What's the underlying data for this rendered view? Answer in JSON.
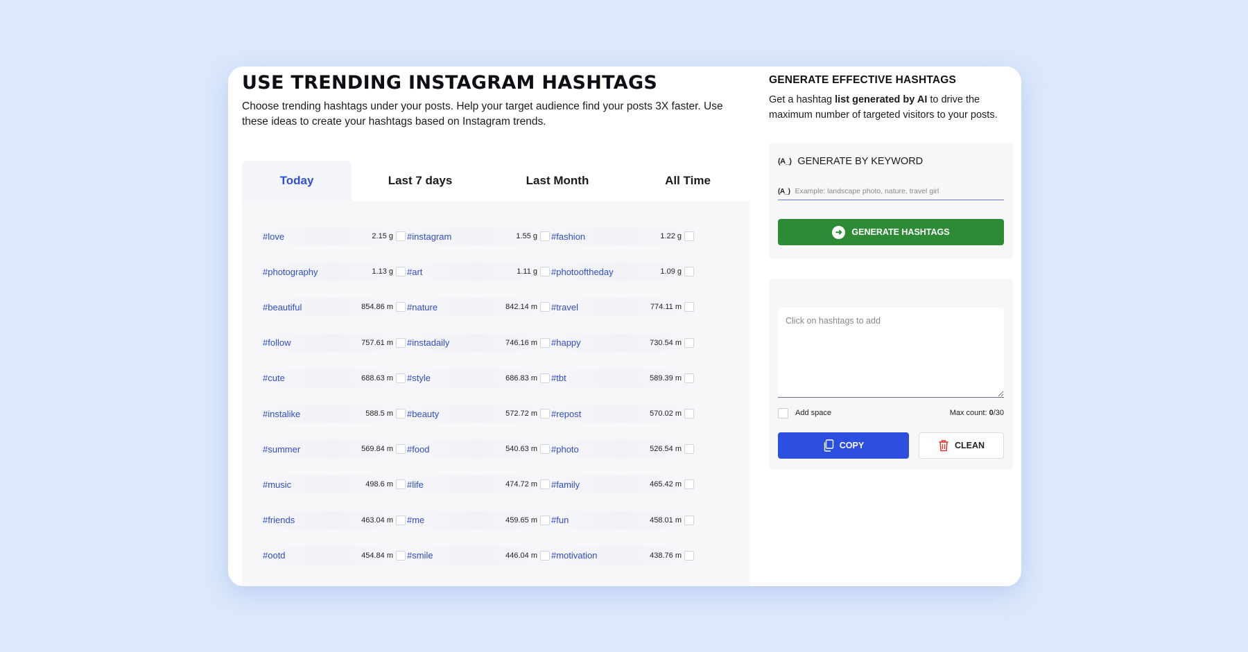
{
  "header": {
    "title": "USE TRENDING INSTAGRAM HASHTAGS",
    "description": "Choose trending hashtags under your posts. Help your target audience find your posts 3X faster. Use these ideas to create your hashtags based on Instagram trends."
  },
  "tabs": [
    {
      "label": "Today",
      "active": true
    },
    {
      "label": "Last 7 days",
      "active": false
    },
    {
      "label": "Last Month",
      "active": false
    },
    {
      "label": "All Time",
      "active": false
    }
  ],
  "hashtags": [
    {
      "name": "#love",
      "count": "2.15 g",
      "checked": false
    },
    {
      "name": "#instagram",
      "count": "1.55 g",
      "checked": false
    },
    {
      "name": "#fashion",
      "count": "1.22 g",
      "checked": false
    },
    {
      "name": "#photography",
      "count": "1.13 g",
      "checked": false
    },
    {
      "name": "#art",
      "count": "1.11 g",
      "checked": false
    },
    {
      "name": "#photooftheday",
      "count": "1.09 g",
      "checked": false
    },
    {
      "name": "#beautiful",
      "count": "854.86 m",
      "checked": false
    },
    {
      "name": "#nature",
      "count": "842.14 m",
      "checked": false
    },
    {
      "name": "#travel",
      "count": "774.11 m",
      "checked": false
    },
    {
      "name": "#follow",
      "count": "757.61 m",
      "checked": false
    },
    {
      "name": "#instadaily",
      "count": "746.16 m",
      "checked": false
    },
    {
      "name": "#happy",
      "count": "730.54 m",
      "checked": false
    },
    {
      "name": "#cute",
      "count": "688.63 m",
      "checked": false
    },
    {
      "name": "#style",
      "count": "686.83 m",
      "checked": false
    },
    {
      "name": "#tbt",
      "count": "589.39 m",
      "checked": false
    },
    {
      "name": "#instalike",
      "count": "588.5 m",
      "checked": false
    },
    {
      "name": "#beauty",
      "count": "572.72 m",
      "checked": false
    },
    {
      "name": "#repost",
      "count": "570.02 m",
      "checked": false
    },
    {
      "name": "#summer",
      "count": "569.84 m",
      "checked": false
    },
    {
      "name": "#food",
      "count": "540.63 m",
      "checked": false
    },
    {
      "name": "#photo",
      "count": "526.54 m",
      "checked": false
    },
    {
      "name": "#music",
      "count": "498.6 m",
      "checked": false
    },
    {
      "name": "#life",
      "count": "474.72 m",
      "checked": false
    },
    {
      "name": "#family",
      "count": "465.42 m",
      "checked": false
    },
    {
      "name": "#friends",
      "count": "463.04 m",
      "checked": false
    },
    {
      "name": "#me",
      "count": "459.65 m",
      "checked": false
    },
    {
      "name": "#fun",
      "count": "458.01 m",
      "checked": false
    },
    {
      "name": "#ootd",
      "count": "454.84 m",
      "checked": false
    },
    {
      "name": "#smile",
      "count": "446.04 m",
      "checked": false
    },
    {
      "name": "#motivation",
      "count": "438.76 m",
      "checked": false
    }
  ],
  "generator": {
    "title": "GENERATE EFFECTIVE HASHTAGS",
    "desc_before": "Get a hashtag ",
    "desc_bold": "list generated by AI",
    "desc_after": " to drive the maximum number of targeted visitors to your posts.",
    "keyword_icon": "(A_)",
    "keyword_label": "GENERATE BY KEYWORD",
    "keyword_placeholder": "Example: landscape photo, nature, travel girl",
    "keyword_value": "",
    "button_label": "GENERATE HASHTAGS"
  },
  "output": {
    "placeholder": "Click on hashtags to add",
    "value": "",
    "add_space_label": "Add space",
    "add_space_checked": false,
    "max_count_label": "Max count:",
    "max_count_current": "0",
    "max_count_limit": "/30",
    "copy_label": "COPY",
    "clean_label": "CLEAN"
  },
  "colors": {
    "accent": "#2f4fd6",
    "generate_button": "#2e8b35",
    "copy_button": "#2c4fe0",
    "clean_icon": "#e0352b",
    "background": "#dde9fd"
  },
  "icons": {
    "keyword": "keyword-ai-icon",
    "generate": "arrow-right-circle-icon",
    "copy": "copy-icon",
    "clean": "trash-icon"
  }
}
